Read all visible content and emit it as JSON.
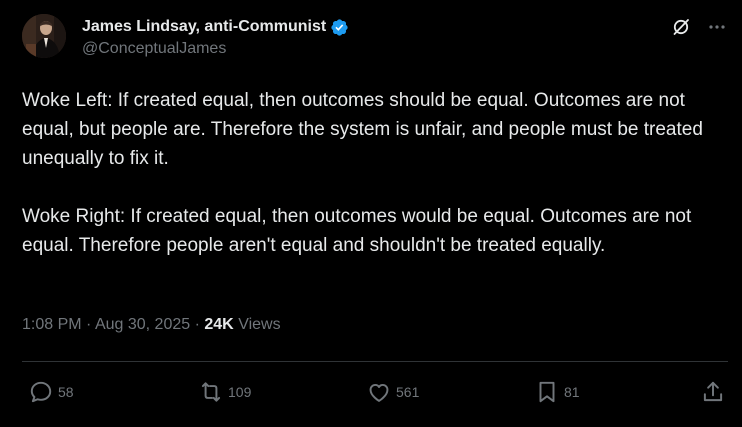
{
  "author": {
    "display_name": "James Lindsay, anti-Communist",
    "handle": "@ConceptualJames",
    "verified": true
  },
  "post": {
    "paragraphs": [
      "Woke Left: If created equal, then outcomes should be equal. Outcomes are not equal, but people are. Therefore the system is unfair, and people must be treated unequally to fix it.",
      "Woke Right: If created equal, then outcomes would be equal. Outcomes are not equal. Therefore people aren't equal and shouldn't be treated equally."
    ],
    "time": "1:08 PM",
    "date": "Aug 30, 2025",
    "views_count": "24K",
    "views_label": "Views"
  },
  "actions": {
    "replies": "58",
    "reposts": "109",
    "likes": "561",
    "bookmarks": "81"
  },
  "colors": {
    "background": "#000000",
    "text": "#e7e9ea",
    "muted": "#71767b",
    "verified": "#1d9bf0",
    "divider": "#2f3336"
  }
}
